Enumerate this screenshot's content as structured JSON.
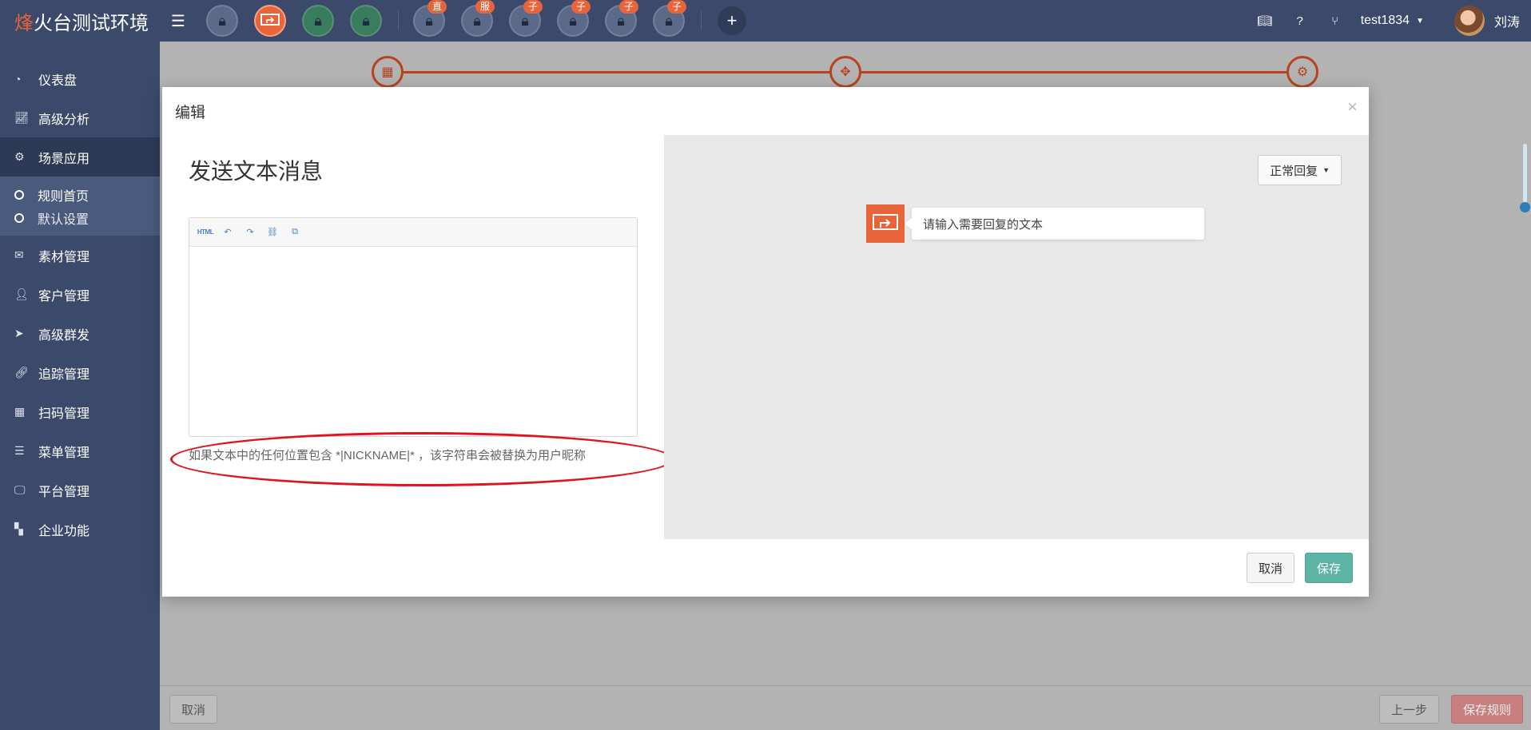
{
  "brand": {
    "accent_char": "烽",
    "rest": "火台测试环境"
  },
  "nav": {
    "accounts": [
      {
        "icon": "lock-icon",
        "badge": "",
        "active": false
      },
      {
        "icon": "reply-icon",
        "badge": "",
        "active": true
      },
      {
        "icon": "lock-icon",
        "badge": "",
        "active": false
      },
      {
        "icon": "lock-icon",
        "badge": "",
        "active": false
      },
      {
        "icon": "lock-icon",
        "badge": "直",
        "active": false
      },
      {
        "icon": "lock-icon",
        "badge": "服",
        "active": false
      },
      {
        "icon": "lock-icon",
        "badge": "子",
        "active": false
      },
      {
        "icon": "lock-icon",
        "badge": "子",
        "active": false
      },
      {
        "icon": "lock-icon",
        "badge": "子",
        "active": false
      },
      {
        "icon": "lock-icon",
        "badge": "子",
        "active": false
      }
    ],
    "username": "test1834",
    "realname": "刘涛"
  },
  "sidebar": {
    "items": [
      {
        "label": "仪表盘",
        "icon": "dashboard-icon"
      },
      {
        "label": "高级分析",
        "icon": "line-chart-icon"
      },
      {
        "label": "场景应用",
        "icon": "gear-icon"
      },
      {
        "label": "素材管理",
        "icon": "envelope-icon"
      },
      {
        "label": "客户管理",
        "icon": "user-icon"
      },
      {
        "label": "高级群发",
        "icon": "paper-plane-icon"
      },
      {
        "label": "追踪管理",
        "icon": "link-icon"
      },
      {
        "label": "扫码管理",
        "icon": "qrcode-icon"
      },
      {
        "label": "菜单管理",
        "icon": "list-icon"
      },
      {
        "label": "平台管理",
        "icon": "monitor-icon"
      },
      {
        "label": "企业功能",
        "icon": "grid-icon"
      }
    ],
    "subitems": [
      {
        "label": "规则首页"
      },
      {
        "label": "默认设置"
      }
    ]
  },
  "modal": {
    "title": "编辑",
    "close": "×",
    "section_title": "发送文本消息",
    "toolbar": {
      "html": "HTML"
    },
    "hint": "如果文本中的任何位置包含 *|NICKNAME|* ，该字符串会被替换为用户昵称",
    "reply_type": "正常回复",
    "preview_placeholder": "请输入需要回复的文本",
    "cancel": "取消",
    "save": "保存"
  },
  "footer": {
    "cancel": "取消",
    "prev": "上一步",
    "save_rule": "保存规则"
  },
  "colors": {
    "nav_bg": "#3b4a6b",
    "accent": "#e8643a",
    "primary": "#5cb5a4",
    "annotation": "#e0141d"
  }
}
